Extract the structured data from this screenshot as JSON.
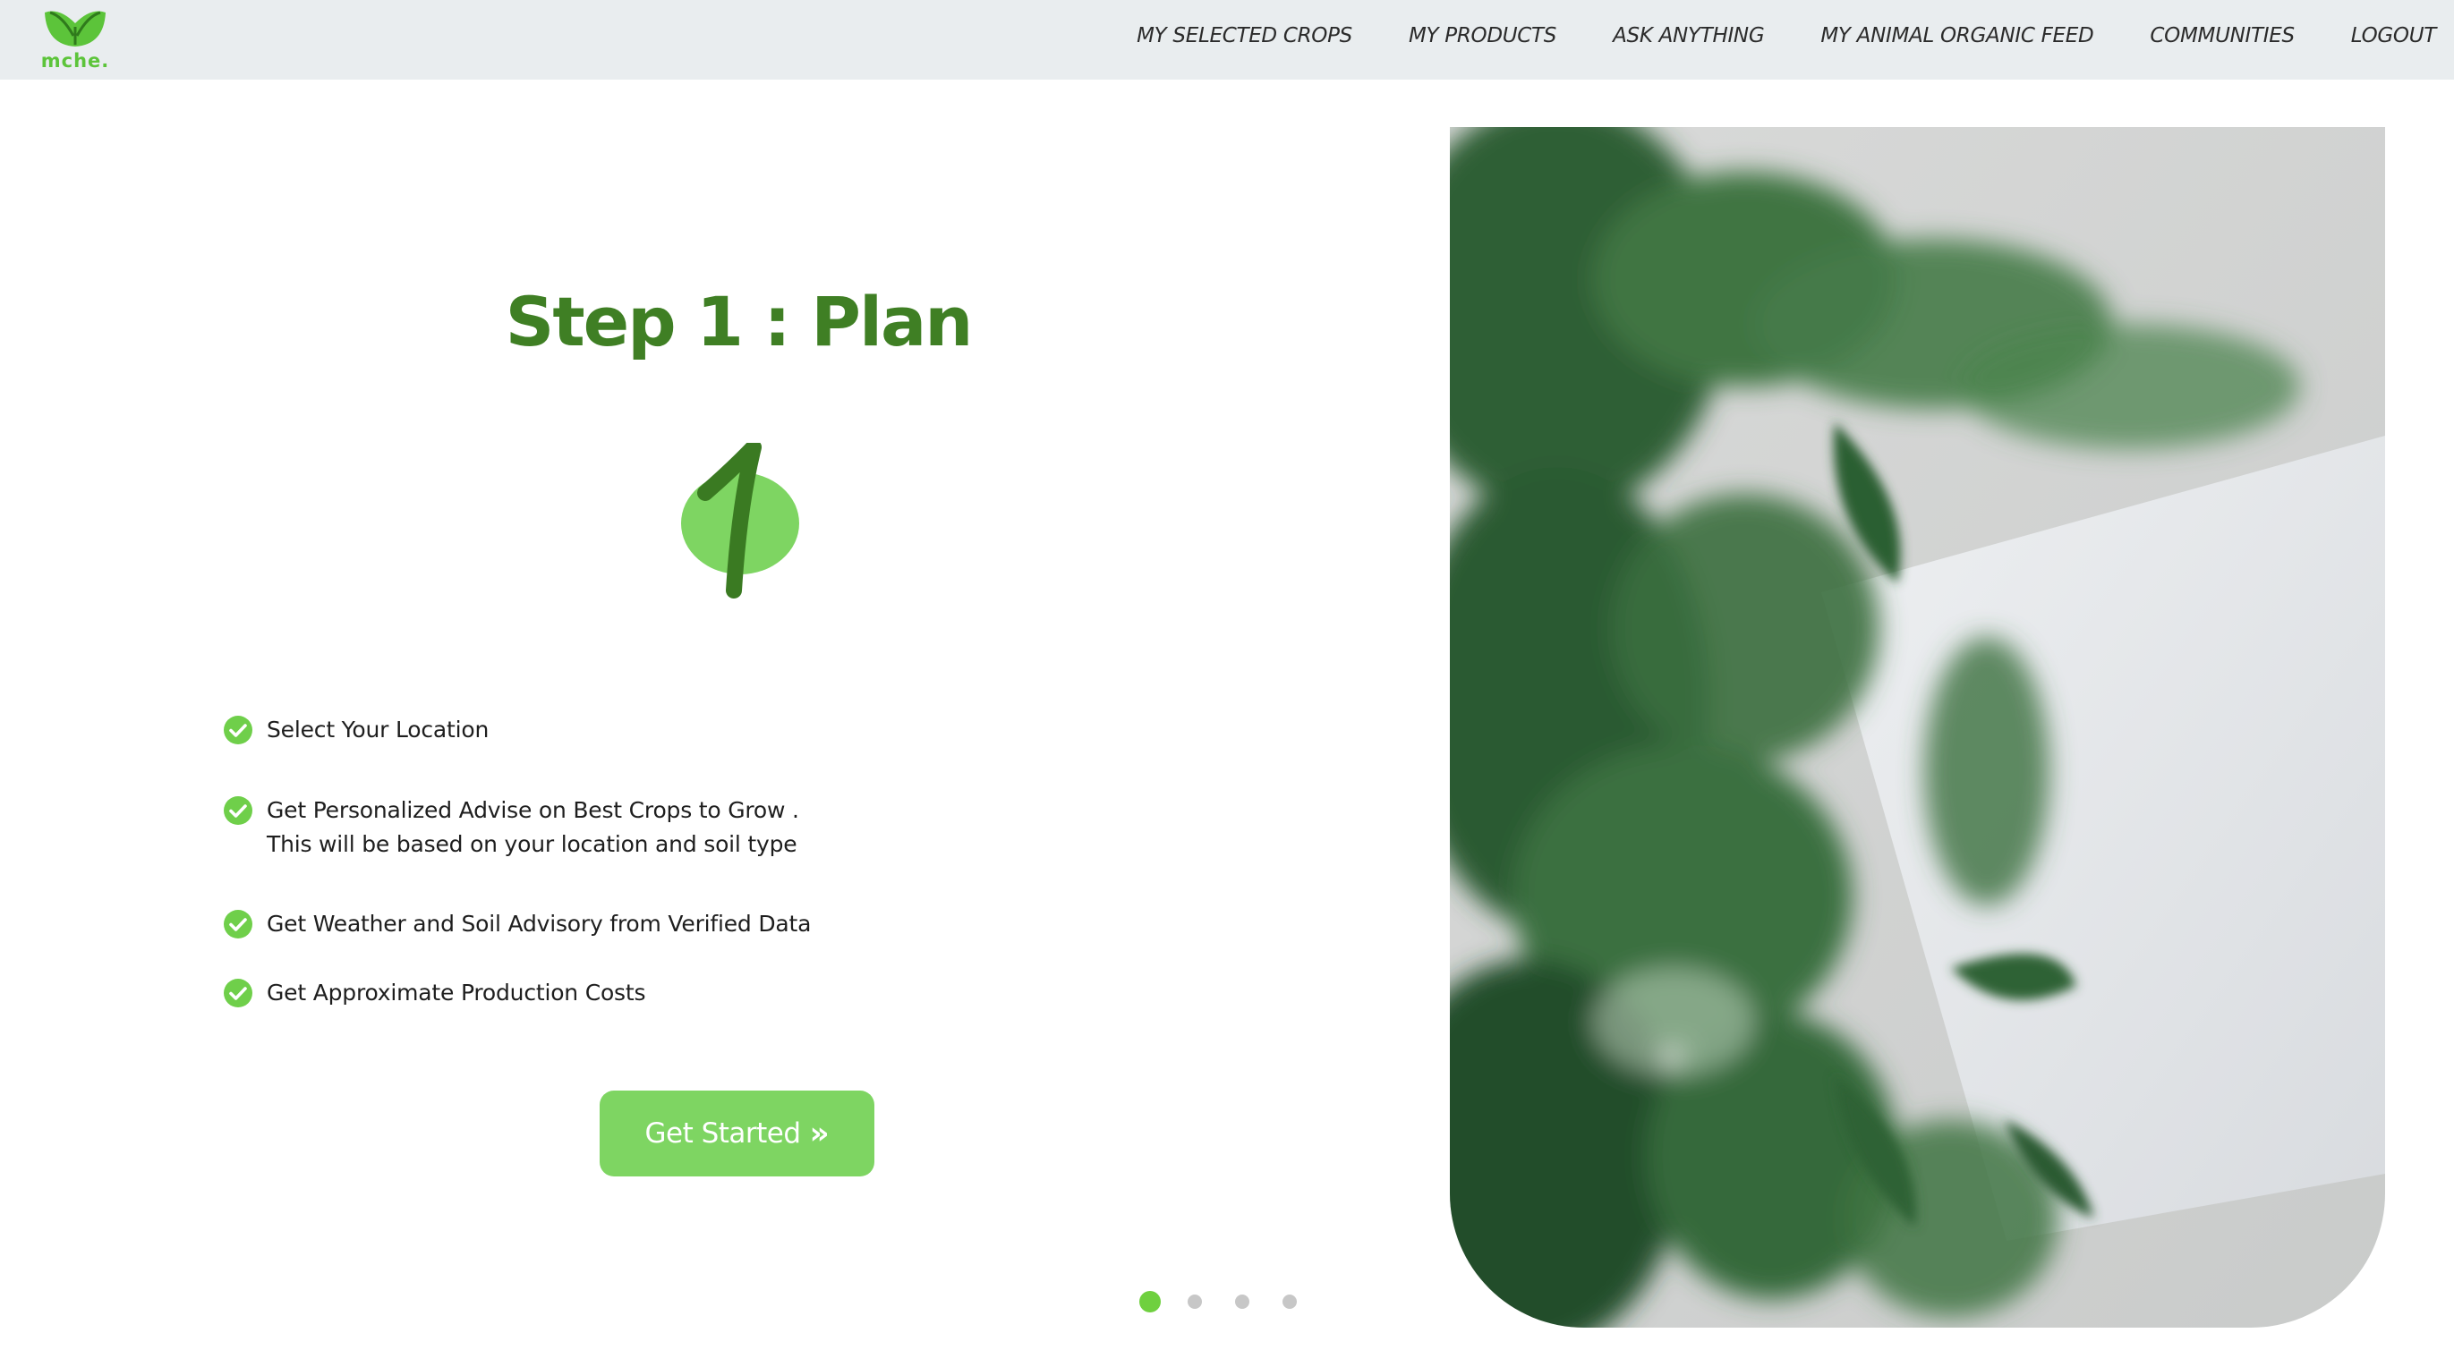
{
  "brand": {
    "logo_text": "mche.",
    "logo_icon": "leaf-cup-logo",
    "accent_color": "#5cc43a"
  },
  "nav": {
    "items": [
      {
        "label": "MY SELECTED CROPS"
      },
      {
        "label": "MY PRODUCTS"
      },
      {
        "label": "ASK ANYTHING"
      },
      {
        "label": "MY ANIMAL ORGANIC FEED"
      },
      {
        "label": "COMMUNITIES"
      },
      {
        "label": "LOGOUT"
      }
    ]
  },
  "slide": {
    "title": "Step 1 : Plan",
    "step_number": "1",
    "title_color": "#3f7f24",
    "checklist": [
      {
        "lines": [
          "Select Your Location"
        ],
        "icon": "check-circle-icon"
      },
      {
        "lines": [
          "Get Personalized Advise on Best Crops to Grow .",
          "This will be based on your location and soil type"
        ],
        "icon": "check-circle-icon"
      },
      {
        "lines": [
          "Get Weather and Soil Advisory from Verified Data"
        ],
        "icon": "check-circle-icon"
      },
      {
        "lines": [
          "Get Approximate Production Costs"
        ],
        "icon": "check-circle-icon"
      }
    ],
    "cta_label": "Get Started",
    "cta_icon": "double-chevron-right-icon",
    "cta_color": "#7ed562"
  },
  "carousel": {
    "slide_count": 4,
    "active_index": 0,
    "active_color": "#6fd03f",
    "inactive_color": "#c7c7c7"
  },
  "hero_image": {
    "subject": "blurred green plant leaves over a blank white paper on a grey carpet"
  }
}
